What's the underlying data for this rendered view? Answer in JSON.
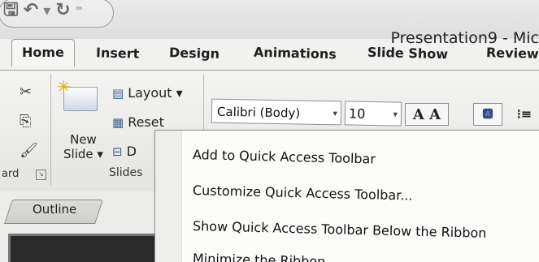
{
  "title_bar": {
    "document_title": "Presentation9 - Mic",
    "qat": [
      {
        "icon": "save-icon",
        "glyph": "🖫"
      },
      {
        "icon": "undo-icon",
        "glyph": "↶"
      },
      {
        "icon": "undo-dropdown-icon",
        "glyph": "▾"
      },
      {
        "icon": "redo-icon",
        "glyph": "↻"
      },
      {
        "icon": "customize-qat-icon",
        "glyph": "⁼"
      }
    ]
  },
  "tabs": [
    {
      "label": "Home"
    },
    {
      "label": "Insert"
    },
    {
      "label": "Design"
    },
    {
      "label": "Animations"
    },
    {
      "label": "Slide Show"
    },
    {
      "label": "Review"
    }
  ],
  "ribbon": {
    "clipboard": {
      "label": "ard",
      "icons": {
        "cut": "✂",
        "copy": "⎘",
        "format_painter": "🖌",
        "launcher": "↘"
      }
    },
    "slides": {
      "new_slide_label_1": "New",
      "new_slide_label_2": "Slide",
      "new_slide_arrow": "▾",
      "layout_label": "Layout",
      "layout_arrow": "▾",
      "reset_label": "Reset",
      "delete_label": "D",
      "group_label": "Slides"
    },
    "font": {
      "font_name": "Calibri (Body)",
      "font_size": "10",
      "grow_label": "A A",
      "combo_arrow": "▾",
      "clear_icon": "🅰",
      "list_icon": "⁝≡"
    }
  },
  "panel": {
    "outline_tab": "Outline"
  },
  "context_menu": {
    "items": [
      {
        "label": "Add to Quick Access Toolbar"
      },
      {
        "label": "Customize Quick Access Toolbar..."
      },
      {
        "label": "Show Quick Access Toolbar Below the Ribbon"
      },
      {
        "label": "Minimize the Ribbon"
      }
    ]
  }
}
